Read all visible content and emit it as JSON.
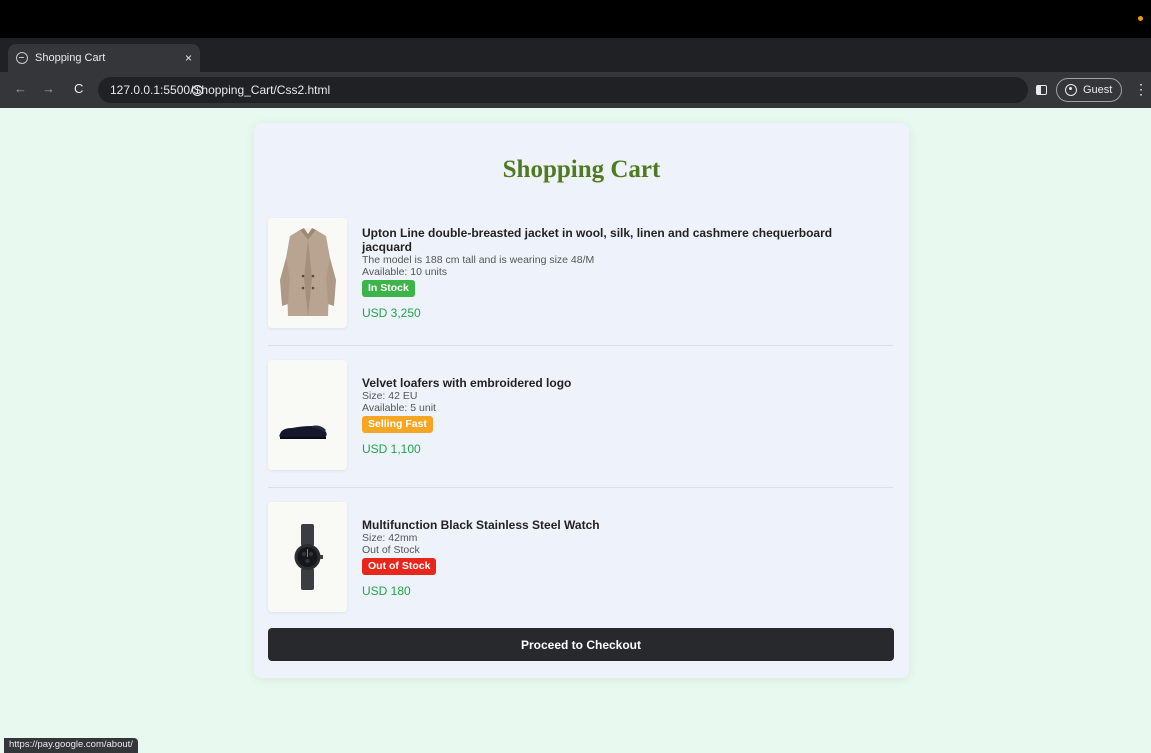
{
  "browser": {
    "tab_title": "Shopping Cart",
    "tab_close": "×",
    "new_tab": "+",
    "tab_menu": "⌄",
    "back": "←",
    "forward": "→",
    "reload": "C",
    "url": "127.0.0.1:5500/Shopping_Cart/Css2.html",
    "profile_label": "Guest",
    "menu": "⋮",
    "status_url": "https://pay.google.com/about/"
  },
  "page": {
    "heading": "Shopping Cart",
    "checkout_label": "Proceed to Checkout"
  },
  "items": [
    {
      "icon": "jacket-image",
      "name": "Upton Line double-breasted jacket in wool, silk, linen and cashmere chequerboard jacquard",
      "detail": "The model is 188 cm tall and is wearing size 48/M",
      "availability": "Available: 10 units",
      "badge": "In Stock",
      "badge_color": "#3db44a",
      "price": "USD 3,250"
    },
    {
      "icon": "loafers-image",
      "name": "Velvet loafers with embroidered logo",
      "detail": "Size: 42 EU",
      "availability": "Available: 5 unit",
      "badge": "Selling Fast",
      "badge_color": "#f5a623",
      "price": "USD 1,100"
    },
    {
      "icon": "watch-image",
      "name": "Multifunction Black Stainless Steel Watch",
      "detail": "Size: 42mm",
      "availability": "Out of Stock",
      "badge": "Out of Stock",
      "badge_color": "#e8261c",
      "price": "USD 180"
    }
  ],
  "colors": {
    "page_bg": "#e8faef",
    "card_bg": "#eef3fb",
    "heading": "#4f7a21",
    "price": "#1fa54a",
    "button_bg": "#27292d"
  }
}
